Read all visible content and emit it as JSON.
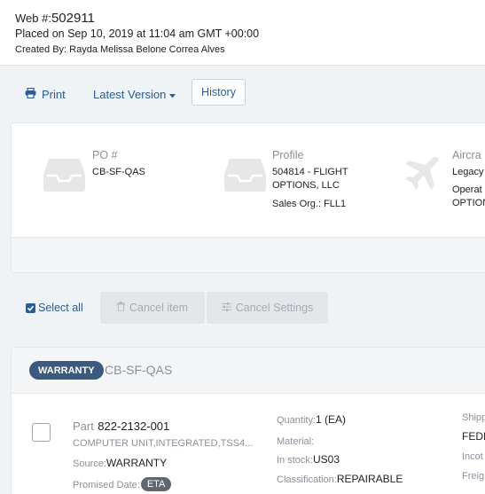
{
  "order": {
    "title_prefix": "Web #:",
    "number": "502911",
    "placed": "Placed on Sep 10, 2019 at 11:04 am GMT +00:00",
    "created_by": "Created By: Rayda Melissa Belone Correa Alves"
  },
  "toolbar": {
    "print_label": "Print",
    "version_label": "Latest Version",
    "history_label": "History"
  },
  "summary": {
    "po": {
      "label": "PO #",
      "value": "CB-SF-QAS"
    },
    "profile": {
      "label": "Profile",
      "line1": "504814 - FLIGHT",
      "line2": "OPTIONS, LLC",
      "sales_org": "Sales Org.: FLL1"
    },
    "aircraft": {
      "label": "Aircra",
      "line1": "Legacy",
      "line2": "Operat",
      "line3": "OPTION"
    }
  },
  "actions": {
    "select_all_label": "Select all",
    "cancel_item_label": "Cancel item",
    "cancel_settings_label": "Cancel Settings"
  },
  "item": {
    "badge": "WARRANTY",
    "po": "CB-SF-QAS",
    "part_label": "Part",
    "part_number": "822-2132-001",
    "description": "COMPUTER UNIT,INTEGRATED,TSS4...",
    "source_label": "Source:",
    "source_value": "WARRANTY",
    "promised_label": "Promised Date:",
    "promised_badge": "ETA",
    "quantity_label": "Quantity:",
    "quantity_value": "1 (EA)",
    "material_label": "Material:",
    "in_stock_label": "In stock:",
    "in_stock_value": "US03",
    "classification_label": "Classification:",
    "classification_value": "REPAIRABLE",
    "shipping_label": "Shipp",
    "shipping_value": "FEDE",
    "incoterms_label": "Incot",
    "freight_label": "Freig"
  },
  "colors": {
    "link": "#2a5d96",
    "badge": "#3c5a7d",
    "muted": "#8a9199",
    "background": "#f0f3f5"
  }
}
